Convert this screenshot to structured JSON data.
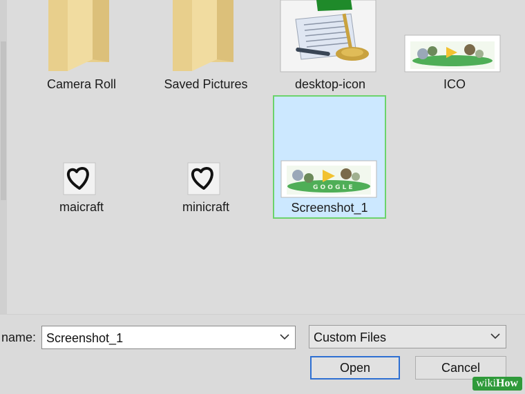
{
  "files": [
    {
      "label": "Camera Roll",
      "icon": "folder-icon"
    },
    {
      "label": "Saved Pictures",
      "icon": "folder-icon"
    },
    {
      "label": "desktop-icon",
      "icon": "image-thumbnail-icon"
    },
    {
      "label": "ICO",
      "icon": "image-thumbnail-icon"
    },
    {
      "label": "maicraft",
      "icon": "heart-outline-icon"
    },
    {
      "label": "minicraft",
      "icon": "heart-outline-icon"
    },
    {
      "label": "Screenshot_1",
      "icon": "image-thumbnail-icon",
      "selected": true
    }
  ],
  "footer": {
    "filename_label": "name:",
    "filename_value": "Screenshot_1",
    "filetype_value": "Custom Files",
    "open_label": "Open",
    "cancel_label": "Cancel"
  },
  "watermark": {
    "text_prefix": "wiki",
    "text_suffix": "How"
  },
  "colors": {
    "selection_fill": "#cce8ff",
    "selection_border": "#6bd36b",
    "primary_border": "#2d6fd2"
  }
}
